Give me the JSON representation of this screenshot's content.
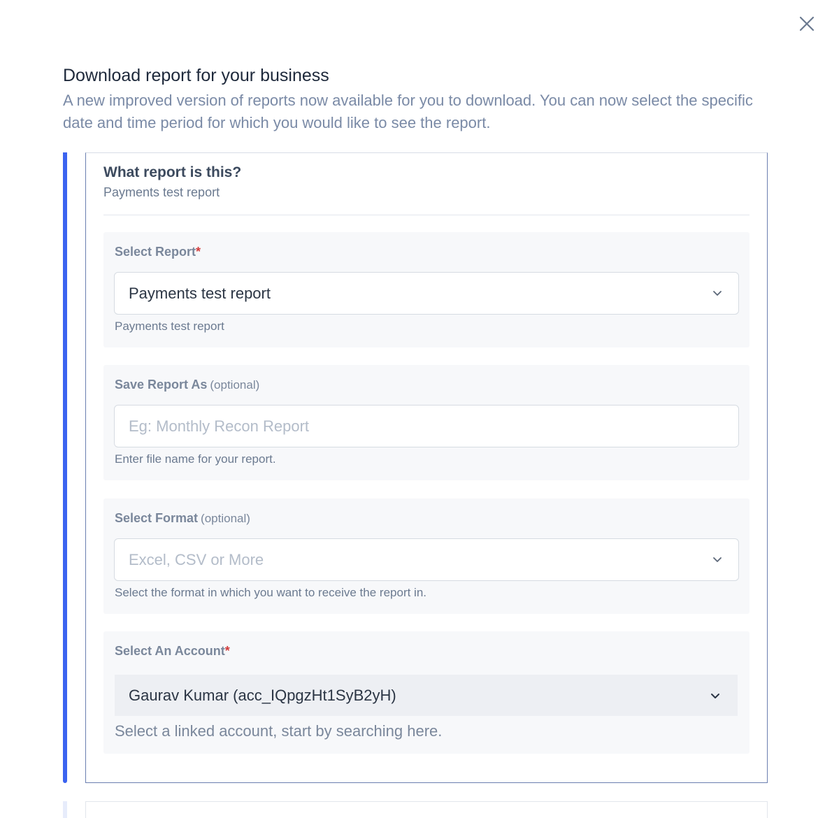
{
  "dialog": {
    "title": "Download report for your business",
    "subtitle": "A new improved version of reports now available for you to download. You can now select the specific date and time period for which you would like to see the report."
  },
  "card": {
    "heading": "What report is this?",
    "subheading": "Payments test report"
  },
  "fields": {
    "select_report": {
      "label": "Select Report",
      "required_mark": "*",
      "value": "Payments test report",
      "helper": "Payments test report"
    },
    "save_report_as": {
      "label": "Save Report As",
      "optional": "(optional)",
      "placeholder": "Eg: Monthly Recon Report",
      "helper": "Enter file name for your report."
    },
    "select_format": {
      "label": "Select Format",
      "optional": "(optional)",
      "placeholder": "Excel, CSV or More",
      "helper": "Select the format in which you want to receive the report in."
    },
    "select_account": {
      "label": "Select An Account",
      "required_mark": "*",
      "value": "Gaurav Kumar (acc_IQpgzHt1SyB2yH)",
      "helper": "Select a linked account, start by searching here."
    }
  },
  "icons": {
    "close": "close-icon",
    "dropdown": "chevron-down-icon"
  },
  "colors": {
    "accent": "#3b63f0",
    "required": "#d23c3c"
  }
}
